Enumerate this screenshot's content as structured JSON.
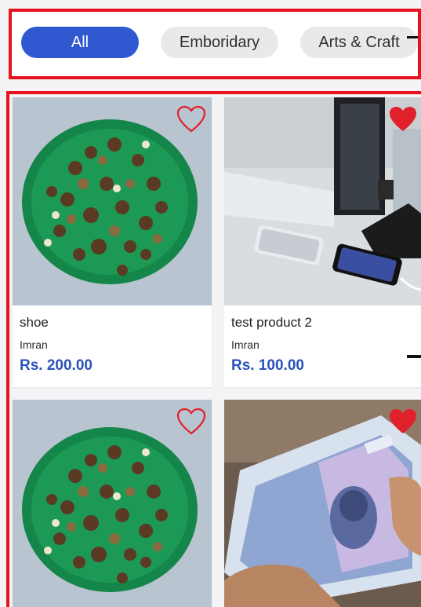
{
  "filters": {
    "categories": [
      "All",
      "Emboridary",
      "Arts & Craft"
    ],
    "selected": "All"
  },
  "products": [
    {
      "title": "shoe",
      "seller": "Imran",
      "price": "Rs. 200.00",
      "favorited": false,
      "image": "nuts-on-green-plate"
    },
    {
      "title": "test product 2",
      "seller": "Imran",
      "price": "Rs. 100.00",
      "favorited": true,
      "image": "phones-on-desk"
    },
    {
      "title": "",
      "seller": "",
      "price": "",
      "favorited": false,
      "image": "nuts-on-green-plate"
    },
    {
      "title": "",
      "seller": "",
      "price": "",
      "favorited": true,
      "image": "banknotes-in-hand"
    }
  ],
  "colors": {
    "accent": "#2f58d1",
    "price": "#2a52b8",
    "highlight_border": "#e8121e",
    "heart": "#e0202a"
  }
}
